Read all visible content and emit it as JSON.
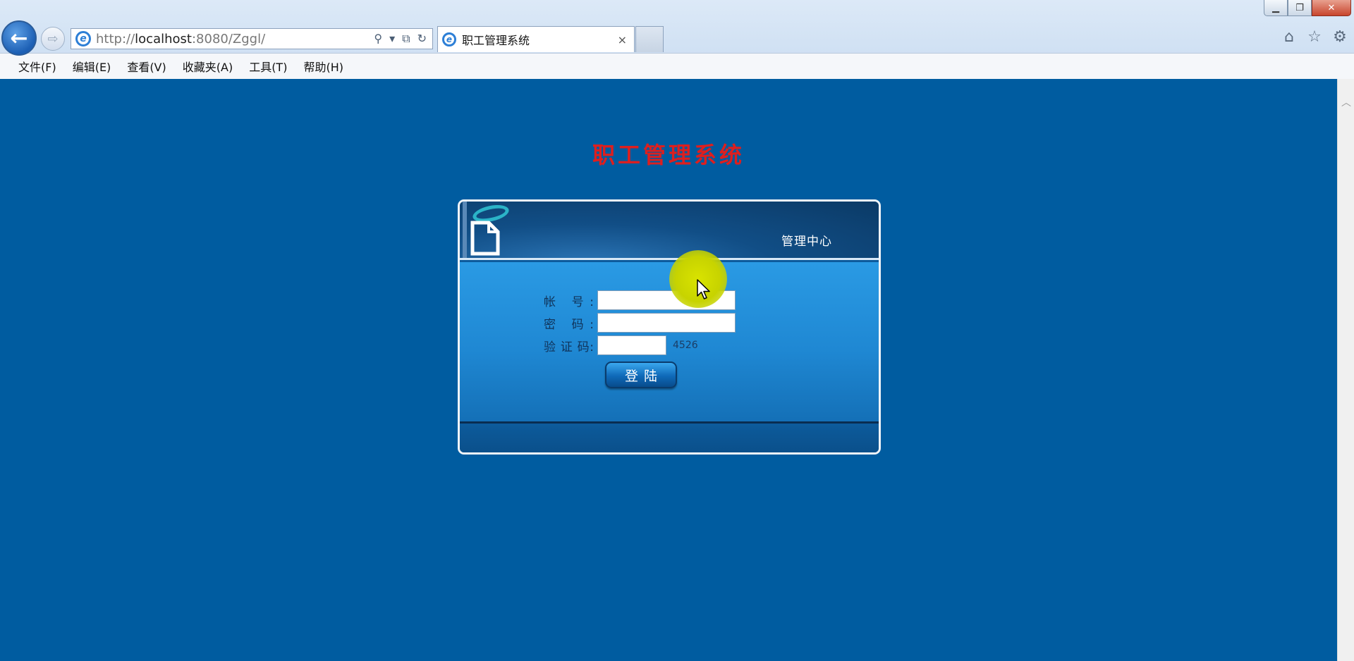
{
  "browser": {
    "address_prefix": "http://",
    "address_host": "localhost",
    "address_rest": ":8080/Zggl/",
    "tab_title": "职工管理系统",
    "tab_close": "×",
    "menu": [
      "文件(F)",
      "编辑(E)",
      "查看(V)",
      "收藏夹(A)",
      "工具(T)",
      "帮助(H)"
    ]
  },
  "page": {
    "title": "职工管理系统",
    "panel_title": "管理中心",
    "fields": {
      "account_label": "帐 号:",
      "account_value": "",
      "password_label": "密 码:",
      "password_value": "",
      "captcha_label": "验 证 码:",
      "captcha_value": "",
      "captcha_code": "4526"
    },
    "login_button": "登陆"
  },
  "colors": {
    "page_background": "#005ca0",
    "title_color": "#dd1f1f",
    "accent": "#2a9ae4"
  }
}
